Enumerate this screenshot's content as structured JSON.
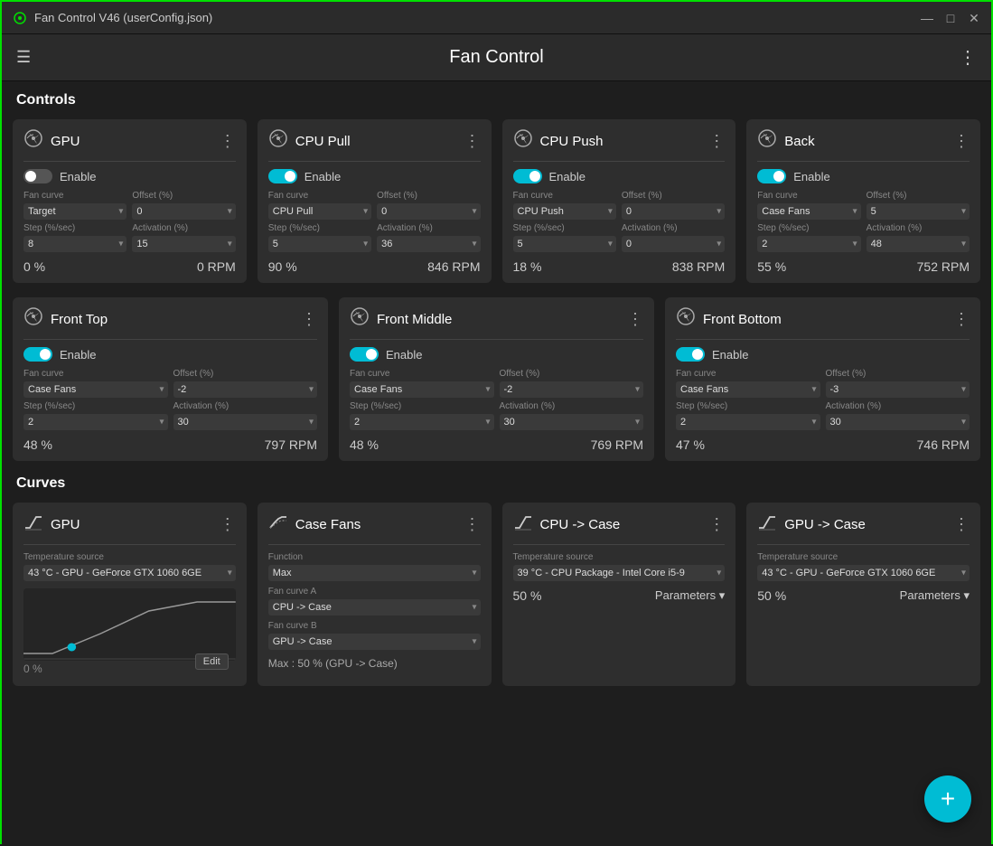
{
  "titlebar": {
    "title": "Fan Control V46 (userConfig.json)",
    "icon": "fan-icon",
    "controls": [
      "minimize",
      "maximize",
      "close"
    ]
  },
  "header": {
    "title": "Fan Control",
    "menu_icon": "☰",
    "dots_icon": "⋮"
  },
  "sections": {
    "controls_label": "Controls",
    "curves_label": "Curves"
  },
  "controls": [
    {
      "name": "GPU",
      "enabled": false,
      "fan_curve": "Target",
      "offset": "0",
      "step": "8",
      "activation": "15",
      "percent": "0 %",
      "rpm": "0 RPM"
    },
    {
      "name": "CPU Pull",
      "enabled": true,
      "fan_curve": "CPU Pull",
      "offset": "0",
      "step": "5",
      "activation": "36",
      "percent": "90 %",
      "rpm": "846 RPM"
    },
    {
      "name": "CPU Push",
      "enabled": true,
      "fan_curve": "CPU Push",
      "offset": "0",
      "step": "5",
      "activation": "0",
      "percent": "18 %",
      "rpm": "838 RPM"
    },
    {
      "name": "Back",
      "enabled": true,
      "fan_curve": "Case Fans",
      "offset": "5",
      "step": "2",
      "activation": "48",
      "percent": "55 %",
      "rpm": "752 RPM"
    },
    {
      "name": "Front Top",
      "enabled": true,
      "fan_curve": "Case Fans",
      "offset": "-2",
      "step": "2",
      "activation": "30",
      "percent": "48 %",
      "rpm": "797 RPM"
    },
    {
      "name": "Front Middle",
      "enabled": true,
      "fan_curve": "Case Fans",
      "offset": "-2",
      "step": "2",
      "activation": "30",
      "percent": "48 %",
      "rpm": "769 RPM"
    },
    {
      "name": "Front Bottom",
      "enabled": true,
      "fan_curve": "Case Fans",
      "offset": "-3",
      "step": "2",
      "activation": "30",
      "percent": "47 %",
      "rpm": "746 RPM"
    }
  ],
  "curves": [
    {
      "name": "GPU",
      "type": "linear",
      "temp_source": "43 °C - GPU - GeForce GTX 1060 6GE",
      "percent": "0 %",
      "has_chart": true,
      "has_edit": true
    },
    {
      "name": "Case Fans",
      "type": "max",
      "function": "Max",
      "fan_curve_a": "CPU -> Case",
      "fan_curve_b": "GPU -> Case",
      "max_info": "Max : 50 % (GPU -> Case)",
      "has_chart": false
    },
    {
      "name": "CPU -> Case",
      "type": "linear",
      "temp_source": "39 °C - CPU Package - Intel Core i5-9",
      "percent": "50 %",
      "has_params": true
    },
    {
      "name": "GPU -> Case",
      "type": "linear",
      "temp_source": "43 °C - GPU - GeForce GTX 1060 6GE",
      "percent": "50 %",
      "has_params": true
    }
  ],
  "labels": {
    "enable": "Enable",
    "fan_curve": "Fan curve",
    "offset": "Offset (%)",
    "step": "Step (%/sec)",
    "activation": "Activation (%)",
    "function": "Function",
    "fan_curve_a": "Fan curve A",
    "fan_curve_b": "Fan curve B",
    "temperature_source": "Temperature source",
    "parameters": "Parameters",
    "edit": "Edit"
  },
  "fab": {
    "icon": "+"
  }
}
